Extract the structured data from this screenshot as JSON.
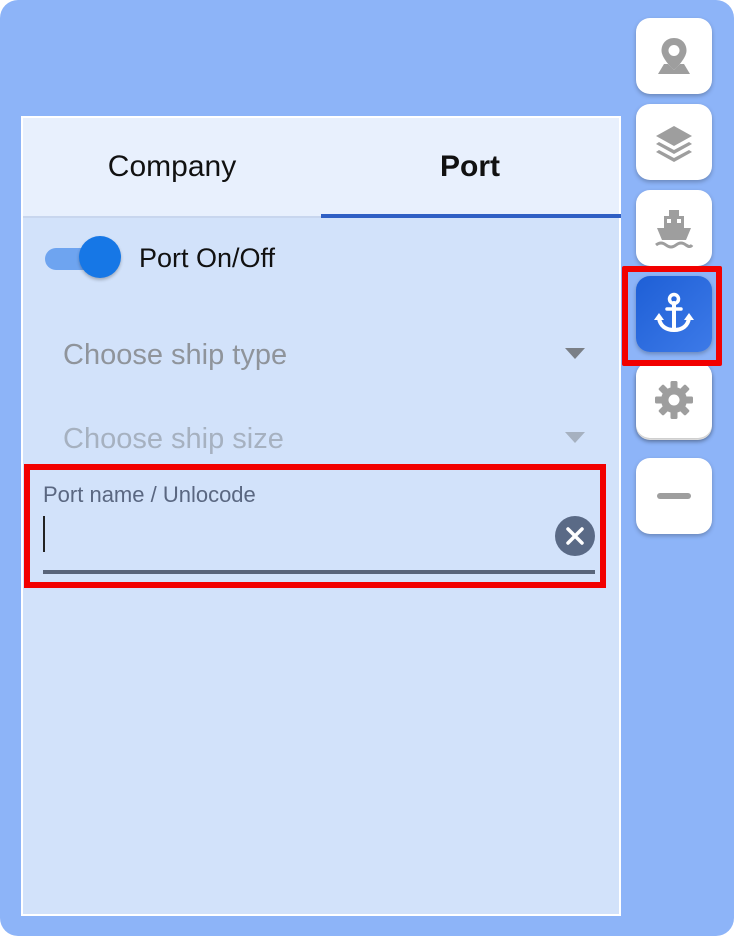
{
  "tabs": {
    "company": "Company",
    "port": "Port"
  },
  "toggle": {
    "label": "Port On/Off",
    "on": true
  },
  "filters": {
    "ship_type_placeholder": "Choose ship type",
    "ship_size_placeholder": "Choose ship size"
  },
  "port_field": {
    "label": "Port name / Unlocode",
    "value": ""
  },
  "sidebar": {
    "buttons": [
      {
        "icon": "map-pin-icon",
        "active": false
      },
      {
        "icon": "layers-icon",
        "active": false
      },
      {
        "icon": "ship-icon",
        "active": false
      },
      {
        "icon": "anchor-icon",
        "active": true
      },
      {
        "icon": "gear-icon",
        "active": false
      },
      {
        "icon": "minus-icon",
        "active": false
      }
    ]
  },
  "colors": {
    "background": "#8db4f8",
    "panel": "#d2e2fa",
    "accent": "#2f5fc4",
    "active_button": "#1e5fd6",
    "highlight": "#f20000"
  }
}
